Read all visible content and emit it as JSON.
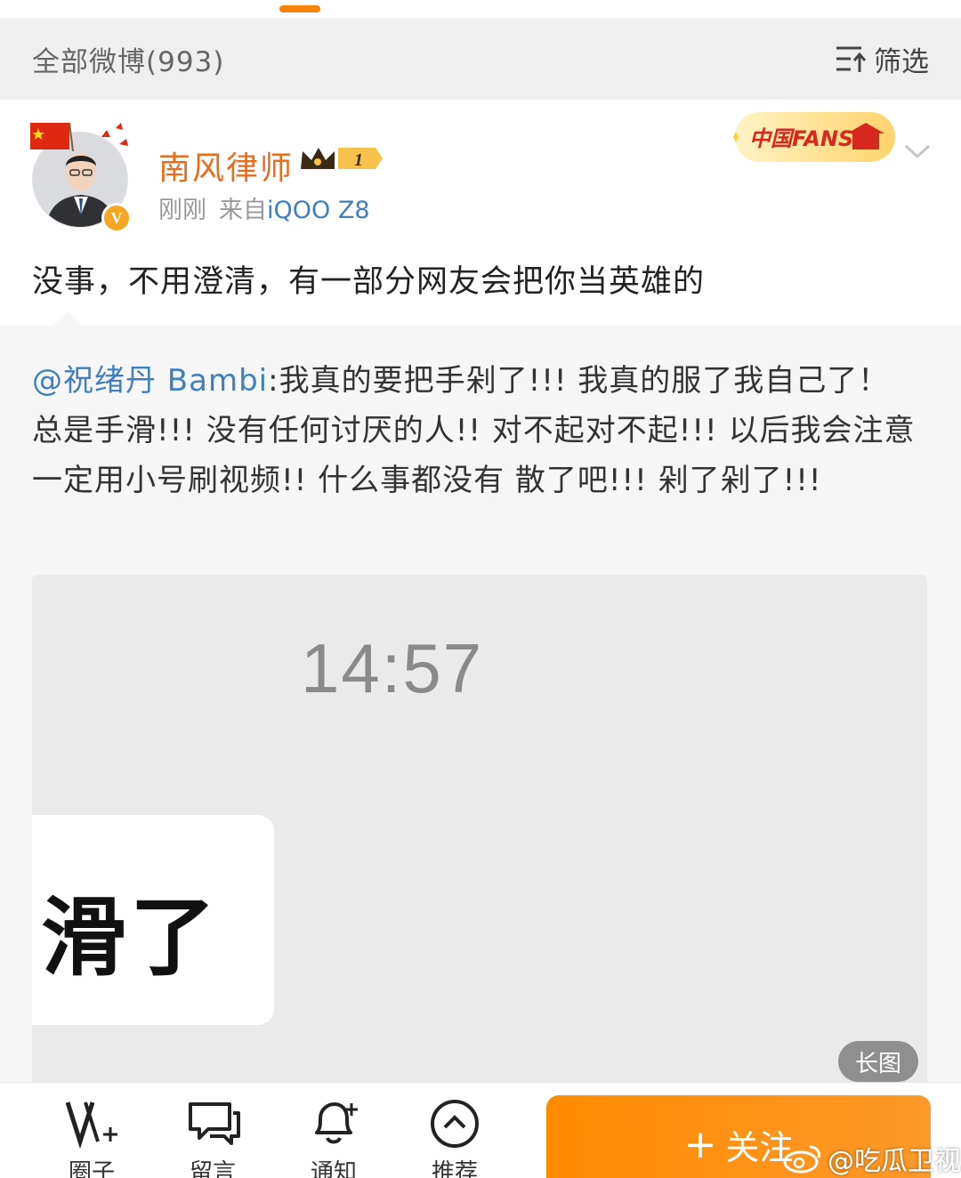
{
  "header": {
    "all_posts_label": "全部微博",
    "all_posts_count": "(993)",
    "filter_label": "筛选"
  },
  "post": {
    "user_name": "南风律师",
    "vip_level": "1",
    "time": "刚刚",
    "source_prefix": "来自",
    "device": "iQOO Z8",
    "text": "没事，不用澄清，有一部分网友会把你当英雄的",
    "badge": "中国FANS",
    "verified_mark": "V"
  },
  "repost": {
    "mention": "@祝绪丹 Bambi",
    "text": ":我真的要把手剁了!!! 我真的服了我自己了！ 总是手滑!!! 没有任何讨厌的人!! 对不起对不起!!! 以后我会注意 一定用小号刷视频!! 什么事都没有 散了吧!!! 剁了剁了!!!",
    "image": {
      "time": "14:57",
      "bubble_text": "滑了",
      "long_image_label": "长图"
    }
  },
  "bottom_bar": {
    "items": [
      {
        "label": "圈子",
        "icon": "v-plus-icon"
      },
      {
        "label": "留言",
        "icon": "chat-icon"
      },
      {
        "label": "通知",
        "icon": "bell-plus-icon"
      },
      {
        "label": "推荐",
        "icon": "chevron-up-circle-icon"
      }
    ],
    "follow_label": "关注"
  },
  "watermark": {
    "text": "@吃瓜卫视"
  },
  "colors": {
    "accent": "#ff8200",
    "name": "#e86c1c",
    "link": "#3f7fc0"
  }
}
